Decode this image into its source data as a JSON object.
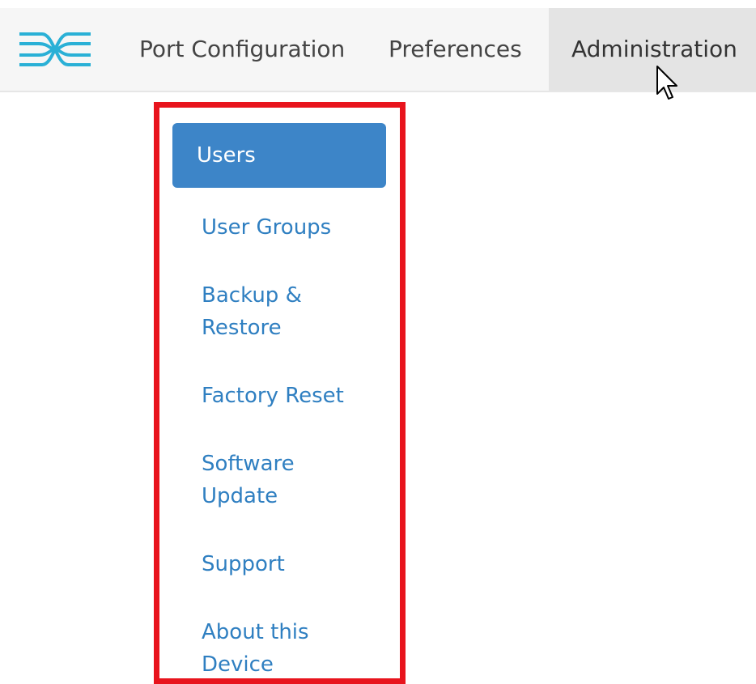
{
  "nav": {
    "logo_icon": "network-switch-logo-icon",
    "items": [
      {
        "label": "Port Configuration"
      },
      {
        "label": "Preferences"
      },
      {
        "label": "Administration",
        "active": true
      }
    ]
  },
  "admin_menu": {
    "items": [
      {
        "label": "Users",
        "active": true
      },
      {
        "label": "User Groups"
      },
      {
        "label": "Backup & Restore"
      },
      {
        "label": "Factory Reset"
      },
      {
        "label": "Software Update"
      },
      {
        "label": "Support"
      },
      {
        "label": "About this Device"
      }
    ]
  },
  "colors": {
    "accent": "#3d85c8",
    "link": "#2f7fc1",
    "highlight_border": "#e8141d",
    "logo": "#2ab0d6"
  }
}
